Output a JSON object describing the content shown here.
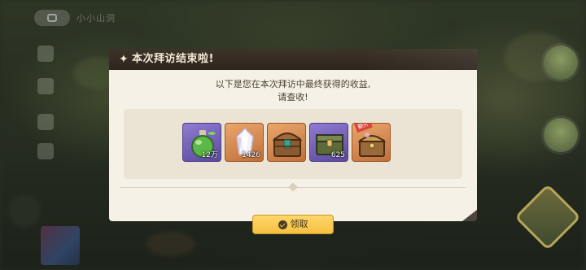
{
  "background": {
    "topbar_text": "小小山洞"
  },
  "dialog": {
    "title": "本次拜访结束啦!",
    "message_line1": "以下是您在本次拜访中最终获得的收益,",
    "message_line2": "请查收!",
    "rewards": [
      {
        "name": "green-potion",
        "quantity": "12万",
        "rarity": "purple"
      },
      {
        "name": "white-crystal",
        "quantity": "1426",
        "rarity": "orange"
      },
      {
        "name": "wooden-chest",
        "quantity": "",
        "rarity": "orange"
      },
      {
        "name": "green-chest",
        "quantity": "625",
        "rarity": "purple"
      },
      {
        "name": "golden-chest",
        "quantity": "",
        "rarity": "orange",
        "badge": "额外"
      }
    ],
    "claim_button": "领取"
  },
  "colors": {
    "header": "#2e261f",
    "body": "#f6f1e6",
    "panel": "#ebe4d4",
    "button": "#f5c041",
    "rarity_purple": "#6f5cb8",
    "rarity_orange": "#d88a4e"
  }
}
